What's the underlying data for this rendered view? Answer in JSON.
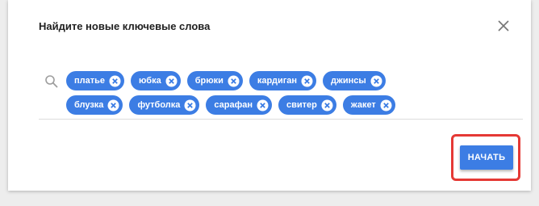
{
  "dialog": {
    "title": "Найдите новые ключевые слова",
    "close_icon": "close-icon"
  },
  "search": {
    "icon": "search-icon",
    "chips": [
      {
        "label": "платье"
      },
      {
        "label": "юбка"
      },
      {
        "label": "брюки"
      },
      {
        "label": "кардиган"
      },
      {
        "label": "джинсы"
      },
      {
        "label": "блузка"
      },
      {
        "label": "футболка"
      },
      {
        "label": "сарафан"
      },
      {
        "label": "свитер"
      },
      {
        "label": "жакет"
      }
    ]
  },
  "actions": {
    "start_label": "НАЧАТЬ"
  },
  "colors": {
    "accent": "#3c7de4",
    "highlight": "#e53935"
  }
}
